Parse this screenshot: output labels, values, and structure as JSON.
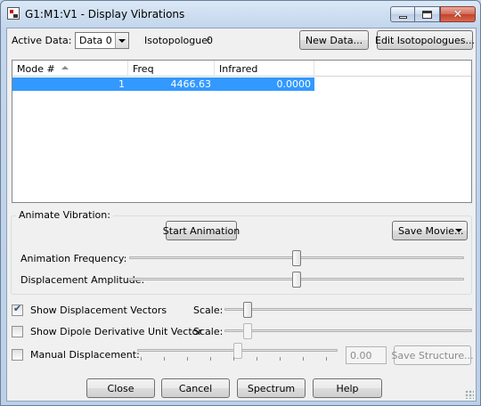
{
  "window": {
    "title": "G1:M1:V1 - Display Vibrations"
  },
  "toolbar": {
    "active_data_label": "Active Data:",
    "active_data_value": "Data 0",
    "isotopologue_label": "Isotopologue:",
    "isotopologue_value": "0",
    "new_data_label": "New Data...",
    "edit_isotopologues_label": "Edit Isotopologues..."
  },
  "table": {
    "columns": [
      "Mode #",
      "Freq",
      "Infrared"
    ],
    "sort_column": "Mode #",
    "sort_direction": "ascending",
    "rows": [
      {
        "mode": "1",
        "freq": "4466.63",
        "infrared": "0.0000",
        "selected": true
      }
    ]
  },
  "animate": {
    "group_label": "Animate Vibration:",
    "start_label": "Start Animation",
    "save_movie_label": "Save Movie...",
    "frequency_label": "Animation Frequency:",
    "frequency_level": 0.5,
    "amplitude_label": "Displacement Amplitude:",
    "amplitude_level": 0.5
  },
  "options": {
    "show_vectors_label": "Show Displacement Vectors",
    "show_vectors_checked": true,
    "vectors_scale_label": "Scale:",
    "vectors_scale_level": 0.08,
    "show_dipole_label": "Show Dipole Derivative Unit Vector",
    "show_dipole_checked": false,
    "dipole_scale_label": "Scale:",
    "dipole_scale_level": 0.08,
    "manual_label": "Manual Displacement:",
    "manual_checked": false,
    "manual_level": 0.5,
    "manual_value": "0.00",
    "save_structure_label": "Save Structure..."
  },
  "footer": {
    "close_label": "Close",
    "cancel_label": "Cancel",
    "spectrum_label": "Spectrum",
    "help_label": "Help"
  }
}
